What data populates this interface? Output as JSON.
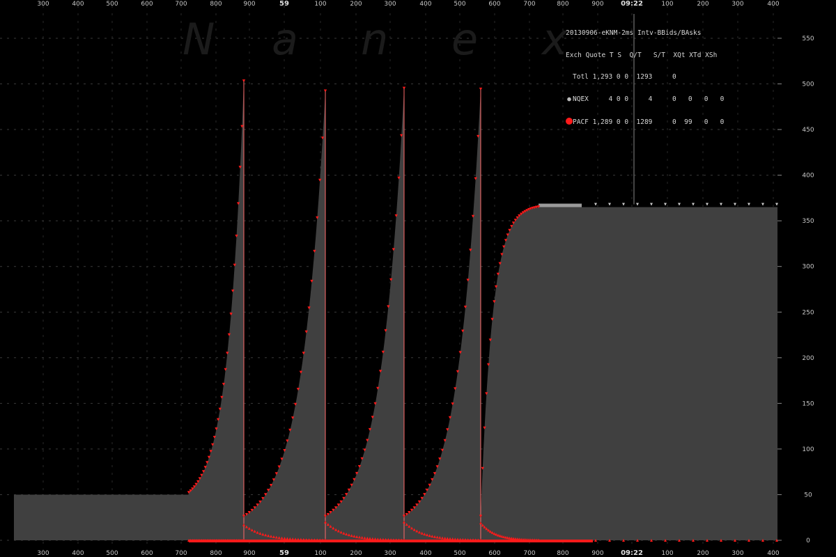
{
  "watermark": [
    "N",
    "a",
    "n",
    "e",
    "x"
  ],
  "legend": {
    "title": "20130906-eKNM-2ms Intv-BBids/BAsks",
    "header": "Exch Quote T S  Q/T   S/T  XQt XTd XSh",
    "rows": [
      {
        "text": "Totl 1,293 0 0  1293     0",
        "marker": "none"
      },
      {
        "text": "NQEX     4 0 0     4     0   0   0   0",
        "marker": "grey-dot"
      },
      {
        "text": "PACF 1,289 0 0  1289     0  99   0   0",
        "marker": "red-dot"
      }
    ]
  },
  "chart_data": {
    "type": "area",
    "y_axis": {
      "ticks": [
        0,
        50,
        100,
        150,
        200,
        250,
        300,
        350,
        400,
        450,
        500,
        550
      ],
      "range": [
        0,
        570
      ],
      "position": "right"
    },
    "x_axis": {
      "tick_labels": [
        "300",
        "400",
        "500",
        "600",
        "700",
        "800",
        "900",
        "59",
        "100",
        "200",
        "300",
        "400",
        "500",
        "600",
        "700",
        "800",
        "900",
        "09:22",
        "100",
        "200",
        "300",
        "400"
      ],
      "bold_labels": [
        "59",
        "09:22"
      ],
      "position": "top-and-bottom"
    },
    "colors": {
      "fill": "#404040",
      "bid_markers": "#ff1a1a",
      "cap": "#9a9a9a",
      "grid": "#3a3a3a"
    },
    "flat_before": {
      "value": 50,
      "from_label": "edge",
      "to_label": "720"
    },
    "cycles": [
      {
        "start_label": "720",
        "end_label": "880",
        "start_value": 52,
        "peak_value": 503,
        "bid_floor": 0
      },
      {
        "start_label": "880",
        "end_label": "100",
        "start_value": 26,
        "peak_value": 492,
        "bid_floor": 17
      },
      {
        "start_label": "100",
        "end_label": "340",
        "start_value": 26,
        "peak_value": 495,
        "bid_floor": 20
      },
      {
        "start_label": "340",
        "end_label": "560",
        "start_value": 26,
        "peak_value": 494,
        "bid_floor": 20
      },
      {
        "start_label": "560",
        "end_label": "740",
        "start_value": 26,
        "peak_value": 365,
        "bid_floor": 19
      }
    ],
    "flat_after": {
      "value": 365,
      "to_label": "400"
    },
    "event_line_label": "09:22"
  }
}
